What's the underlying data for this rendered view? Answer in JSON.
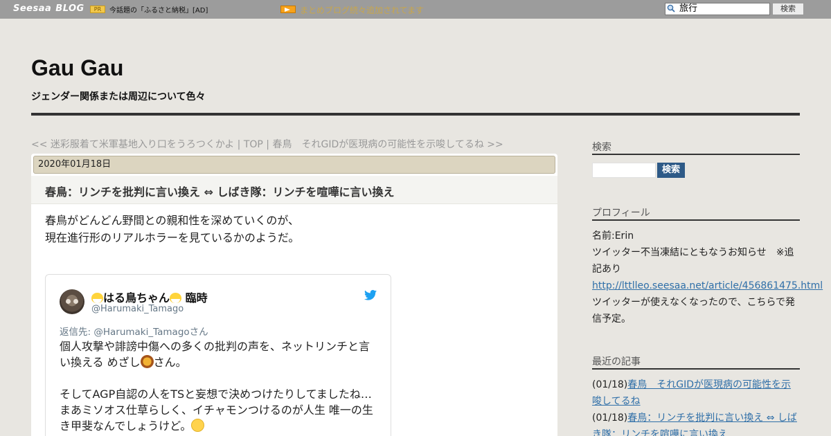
{
  "topbar": {
    "logo_seesaa": "Seesaa",
    "logo_blog": "BLOG",
    "pr_badge": "PR",
    "pr_text": "今話題の「ふるさと納税」[AD]",
    "announcement": "まとめブログ続々追加されてます",
    "search_value": "旅行",
    "search_button": "検索"
  },
  "header": {
    "title": "Gau Gau",
    "description": "ジェンダー関係または周辺について色々"
  },
  "pager": {
    "prev": "<< 迷彩服着て米軍基地入り口をうろつくかよ",
    "separator1": " | ",
    "top": "TOP",
    "separator2": " | ",
    "next": "春鳥　それGIDが医現病の可能性を示唆してるね >>"
  },
  "article": {
    "date": "2020年01月18日",
    "title": "春鳥：リンチを批判に言い換え ⇔ しばき隊：リンチを喧嘩に言い換え",
    "body_line1": "春鳥がどんどん野間との親和性を深めていくのが、",
    "body_line2": "現在進行形のリアルホラーを見ているかのようだ。"
  },
  "tweet": {
    "name": "はる鳥ちゃん",
    "name_suffix": "臨時",
    "handle": "@Harumaki_Tamago",
    "reply_to": "返信先: @Harumaki_Tamagoさん",
    "text1a": "個人攻撃や誹謗中傷への多くの批判の声を、ネットリンチと言い換える めざし",
    "text1b": "さん。",
    "text2": "そしてAGP自認の人をTSと妄想で決めつけたりしてましたね…",
    "text3": "まあミソオス仕草らしく、イチャモンつけるのが人生 唯一の生き甲斐なんでしょうけど。"
  },
  "sidebar": {
    "search_heading": "検索",
    "search_button": "検索",
    "profile_heading": "プロフィール",
    "profile_name": "名前:Erin",
    "profile_notice": "ツイッター不当凍結にともなうお知らせ　※追記あり",
    "profile_link": "http://lttlleo.seesaa.net/article/456861475.html",
    "profile_note": "ツイッターが使えなくなったので、こちらで発信予定。",
    "recent_heading": "最近の記事",
    "recent": [
      {
        "date": "(01/18)",
        "title": "春鳥　それGIDが医現病の可能性を示唆してるね"
      },
      {
        "date": "(01/18)",
        "title": "春鳥：リンチを批判に言い換え ⇔ しばき隊：リンチを喧嘩に言い換え"
      }
    ]
  },
  "colors": {
    "topbar": "#9c9c9c",
    "page_bg": "#e8e6e1",
    "date_bar": "#dcd5c0",
    "link": "#2f6fa8",
    "search_button": "#2e5a87",
    "twitter_blue": "#1da1f2"
  }
}
